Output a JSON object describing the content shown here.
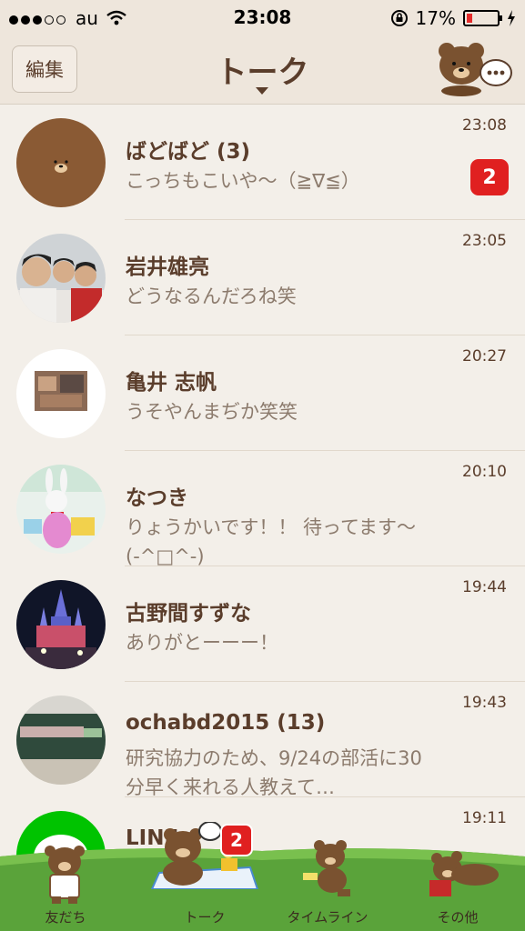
{
  "status_bar": {
    "carrier": "au",
    "time": "23:08",
    "battery": "17%",
    "battery_color": "#e52b2b"
  },
  "header": {
    "edit_label": "編集",
    "title": "トーク"
  },
  "chats": [
    {
      "name": "ばどばど (3)",
      "message": "こっちもこいや〜（≧∇≦）",
      "time": "23:08",
      "badge": "2",
      "avatar": "brown-bear"
    },
    {
      "name": "岩井雄亮",
      "message": "どうなるんだろね笑",
      "time": "23:05",
      "badge": "",
      "avatar": "photo-group"
    },
    {
      "name": "亀井 志帆",
      "message": "うそやんまぢか笑笑",
      "time": "20:27",
      "badge": "",
      "avatar": "photo-small"
    },
    {
      "name": "なつき",
      "message": "りょうかいです！！ 待ってます〜(-^□^-)",
      "time": "20:10",
      "badge": "",
      "avatar": "photo-rabbit"
    },
    {
      "name": "古野間すずな",
      "message": "ありがとーーー！",
      "time": "19:44",
      "badge": "",
      "avatar": "photo-castle"
    },
    {
      "name": "ochabd2015 (13)",
      "message": "研究協力のため、9/24の部活に30分早く来れる人教えて…",
      "time": "19:43",
      "badge": "",
      "avatar": "photo-blackboard"
    },
    {
      "name": "LINE",
      "message": "",
      "time": "19:11",
      "badge": "",
      "avatar": "line-green"
    }
  ],
  "tabs": [
    {
      "label": "友だち",
      "icon": "brown-friends-icon"
    },
    {
      "label": "トーク",
      "icon": "brown-talk-icon",
      "badge": "2"
    },
    {
      "label": "タイムライン",
      "icon": "brown-timeline-icon"
    },
    {
      "label": "その他",
      "icon": "brown-more-icon"
    }
  ]
}
